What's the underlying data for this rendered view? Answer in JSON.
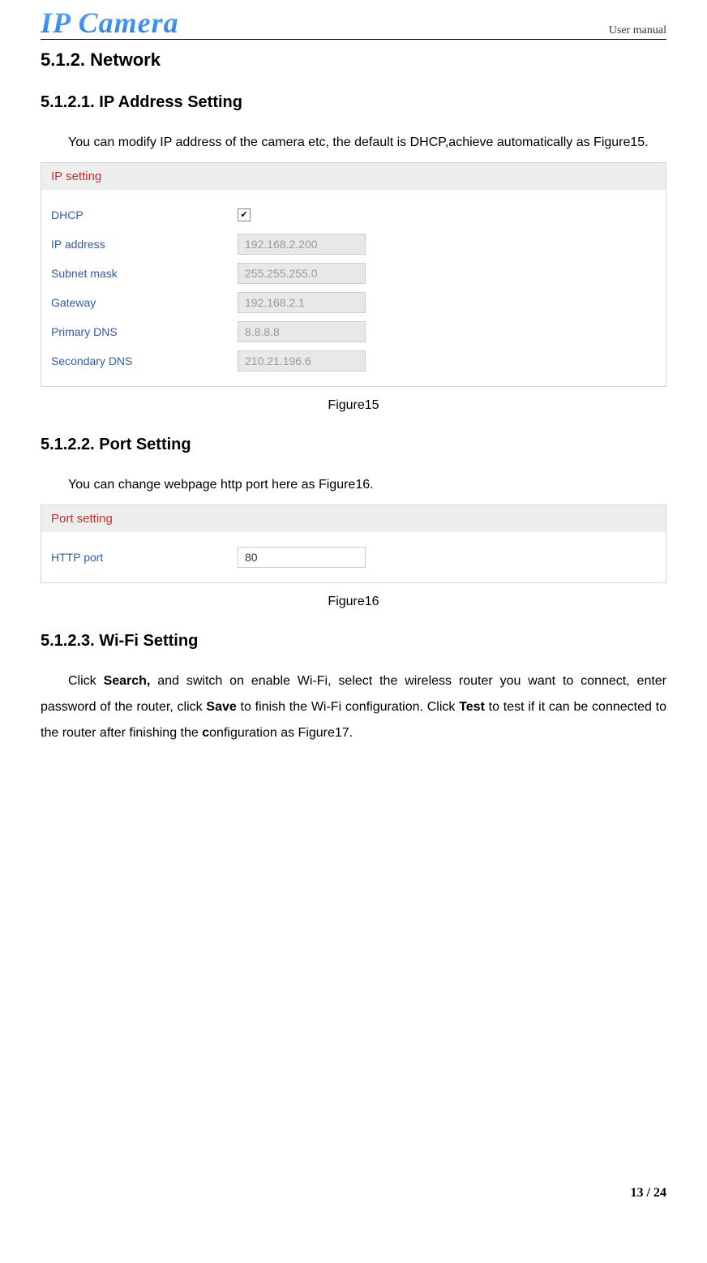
{
  "header": {
    "logo": "IP Camera",
    "right": "User manual"
  },
  "section": {
    "num_title": "5.1.2.  Network"
  },
  "ip": {
    "heading": "5.1.2.1. IP Address Setting",
    "para": "You can modify IP address of the camera etc, the default is DHCP,achieve automatically as Figure15.",
    "panel_title": "IP setting",
    "rows": {
      "dhcp_label": "DHCP",
      "dhcp_checked": "✔",
      "ip_label": "IP address",
      "ip_value": "192.168.2.200",
      "mask_label": "Subnet mask",
      "mask_value": "255.255.255.0",
      "gw_label": "Gateway",
      "gw_value": "192.168.2.1",
      "pdns_label": "Primary DNS",
      "pdns_value": "8.8.8.8",
      "sdns_label": "Secondary DNS",
      "sdns_value": "210.21.196.6"
    },
    "caption": "Figure15"
  },
  "port": {
    "heading": "5.1.2.2. Port Setting",
    "para": "You can change webpage http port here as Figure16.",
    "panel_title": "Port setting",
    "http_label": "HTTP port",
    "http_value": "80",
    "caption": "Figure16"
  },
  "wifi": {
    "heading": "5.1.2.3. Wi-Fi Setting",
    "p_pre": "Click ",
    "p_search": "Search,",
    "p_mid1": " and switch on enable Wi-Fi, select the wireless router you want to connect, enter password of the router, click ",
    "p_save": "Save",
    "p_mid2": " to finish the Wi-Fi configuration. Click ",
    "p_test": "Test",
    "p_end": " to test if it can be connected to the router after finishing the ",
    "p_c": "c",
    "p_tail": "onfiguration as Figure17."
  },
  "footer": "13 / 24"
}
